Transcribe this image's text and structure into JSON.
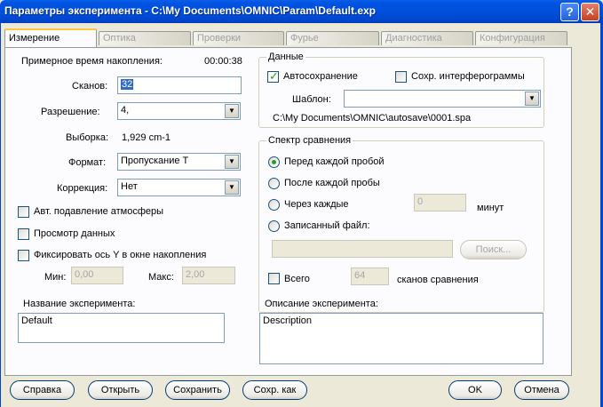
{
  "window": {
    "title": "Параметры эксперимента - C:\\My Documents\\OMNIC\\Param\\Default.exp",
    "help_label": "?",
    "close_label": "✕"
  },
  "tabs": [
    {
      "label": "Измерение",
      "active": true
    },
    {
      "label": "Оптика",
      "active": false
    },
    {
      "label": "Проверки",
      "active": false
    },
    {
      "label": "Фурье",
      "active": false
    },
    {
      "label": "Диагностика",
      "active": false
    },
    {
      "label": "Конфигурация",
      "active": false
    }
  ],
  "measurement": {
    "collection_time_label": "Примерное время накопления:",
    "collection_time_value": "00:00:38",
    "scans_label": "Сканов:",
    "scans_value": "32",
    "resolution_label": "Разрешение:",
    "resolution_value": "4,",
    "sampling_label": "Выборка:",
    "sampling_value": "1,929 cm-1",
    "format_label": "Формат:",
    "format_value": "Пропускание Т",
    "correction_label": "Коррекция:",
    "correction_value": "Нет",
    "atm_suppression_label": "Авт. подавление атмосферы",
    "preview_label": "Просмотр данных",
    "fix_y_label": "Фиксировать ось Y в окне накопления",
    "min_label": "Мин:",
    "min_value": "0,00",
    "max_label": "Макс:",
    "max_value": "2,00"
  },
  "data_group": {
    "legend": "Данные",
    "autosave_label": "Автосохранение",
    "autosave_checked": true,
    "save_interferograms_label": "Сохр. интерферограммы",
    "template_label": "Шаблон:",
    "template_value": "",
    "path": "C:\\My Documents\\OMNIC\\autosave\\0001.spa"
  },
  "background_group": {
    "legend": "Спектр сравнения",
    "before_each_label": "Перед каждой пробой",
    "after_each_label": "После каждой пробы",
    "every_label": "Через каждые",
    "every_value": "0",
    "minutes_label": "минут",
    "saved_file_label": "Записанный файл:",
    "saved_file_value": "",
    "browse_label": "Поиск...",
    "total_label": "Всего",
    "total_value": "64",
    "bg_scans_label": "сканов сравнения"
  },
  "experiment": {
    "name_label": "Название эксперимента:",
    "name_value": "Default",
    "description_label": "Описание эксперимента:",
    "description_value": "Description"
  },
  "buttons": {
    "help": "Справка",
    "open": "Открыть",
    "save": "Сохранить",
    "save_as": "Сохр. как",
    "ok": "OK",
    "cancel": "Отмена"
  }
}
